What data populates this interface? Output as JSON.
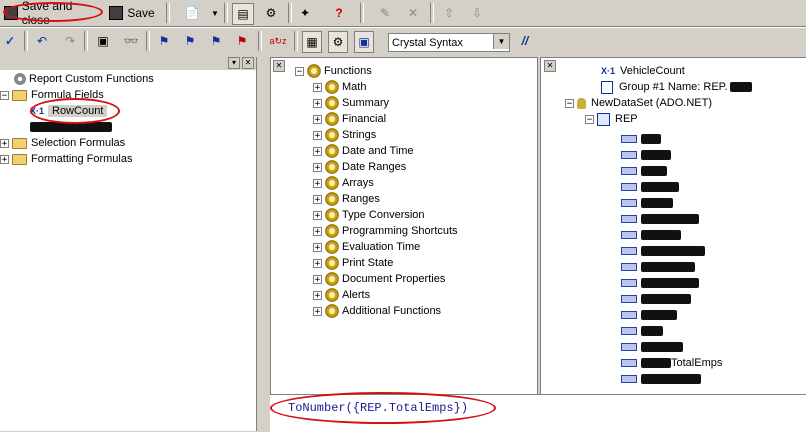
{
  "toolbar_top": {
    "save_and_close": "Save and close",
    "save": "Save"
  },
  "toolbar_second": {
    "syntax_select": "Crystal Syntax"
  },
  "workshop_tree": {
    "items": [
      {
        "label": "Report Custom Functions"
      },
      {
        "label": "Formula Fields"
      },
      {
        "label": "RowCount"
      },
      {
        "label": "Selection Formulas"
      },
      {
        "label": "Formatting Formulas"
      }
    ]
  },
  "functions_tree": {
    "root": "Functions",
    "items": [
      "Math",
      "Summary",
      "Financial",
      "Strings",
      "Date and Time",
      "Date Ranges",
      "Arrays",
      "Ranges",
      "Type Conversion",
      "Programming Shortcuts",
      "Evaluation Time",
      "Print State",
      "Document Properties",
      "Alerts",
      "Additional Functions"
    ]
  },
  "fields_tree": {
    "vehicle_count": "VehicleCount",
    "group_name": "Group #1 Name: REP.",
    "dataset": "NewDataSet (ADO.NET)",
    "table": "REP",
    "total_emps": "TotalEmps"
  },
  "editor": {
    "code": "ToNumber({REP.TotalEmps})"
  },
  "colors": {
    "highlight": "#d41010",
    "code": "#1a1a90"
  }
}
